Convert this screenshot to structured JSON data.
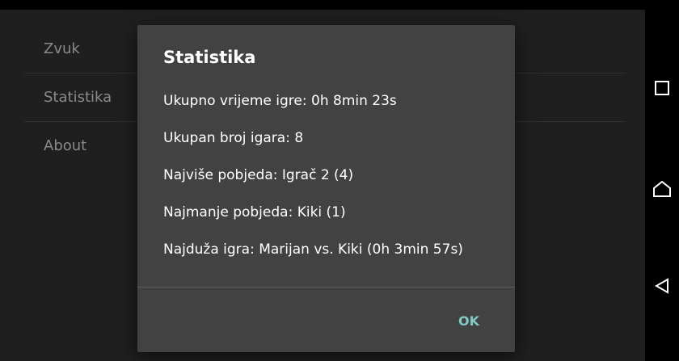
{
  "settings": {
    "items": [
      {
        "label": "Zvuk"
      },
      {
        "label": "Statistika"
      },
      {
        "label": "About"
      }
    ]
  },
  "dialog": {
    "title": "Statistika",
    "lines": [
      "Ukupno vrijeme igre: 0h 8min 23s",
      "Ukupan broj igara: 8",
      "Najviše pobjeda: Igrač 2 (4)",
      "Najmanje pobjeda: Kiki (1)",
      "Najduža igra: Marijan vs. Kiki (0h 3min 57s)"
    ],
    "ok_label": "OK"
  },
  "nav": {
    "recent_icon": "square-icon",
    "home_icon": "home-icon",
    "back_icon": "back-triangle-icon"
  },
  "colors": {
    "accent": "#80cbc4",
    "dialog_bg": "#424242",
    "app_bg": "#1f1f1f"
  }
}
